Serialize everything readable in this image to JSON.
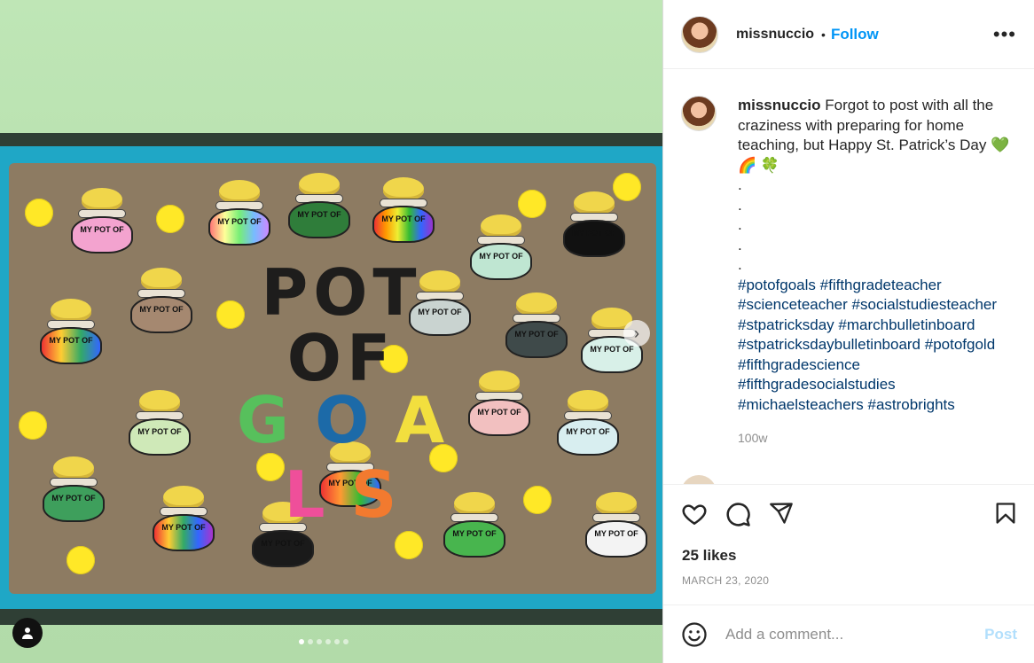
{
  "post": {
    "username": "missnuccio",
    "follow_label": "Follow",
    "more_label": "•••",
    "caption_username": "missnuccio",
    "caption_text": "Forgot to post with all the craziness with preparing for home teaching, but Happy St. Patrick’s Day 💚",
    "caption_emojis": "🌈 🍀",
    "dots": [
      ".",
      ".",
      ".",
      ".",
      "."
    ],
    "hashtags": [
      "#potofgoals",
      "#fifthgradeteacher",
      "#scienceteacher",
      "#socialstudiesteacher",
      "#stpatricksday",
      "#marchbulletinboard",
      "#stpatricksdaybulletinboard",
      "#potofgold",
      "#fifthgradescience",
      "#fifthgradesocialstudies",
      "#michaelsteachers",
      "#astrobrights"
    ],
    "caption_time": "100w",
    "likes": "25 likes",
    "date": "MARCH 23, 2020",
    "comment_placeholder": "Add a comment...",
    "post_label": "Post"
  },
  "board": {
    "title_line1": "POT",
    "title_line2": "OF",
    "title_letters": [
      "G",
      "O",
      "A",
      "L",
      "S"
    ],
    "title_colors": [
      "#57c05c",
      "#1c6aa8",
      "#f2df3e",
      "#ef4f9a",
      "#f27a2f"
    ]
  },
  "carousel": {
    "slides": 6,
    "active": 1
  },
  "icons": {
    "like": "heart-icon",
    "comment": "comment-icon",
    "share": "share-icon",
    "save": "bookmark-icon",
    "emoji": "emoji-icon",
    "tag": "user-tag-icon",
    "next": "chevron-right-icon"
  }
}
